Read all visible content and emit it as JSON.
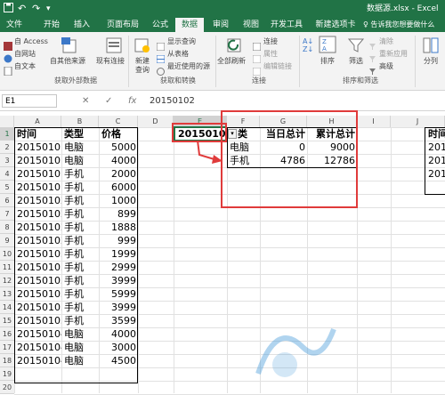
{
  "window": {
    "title": "数据源.xlsx - Excel"
  },
  "quick_access": {
    "undo": "↶",
    "redo": "↷"
  },
  "tabs": [
    "文件",
    "开始",
    "插入",
    "页面布局",
    "公式",
    "数据",
    "审阅",
    "视图",
    "开发工具",
    "新建选项卡"
  ],
  "active_tab": "数据",
  "tell_me": "♀ 告诉我您想要做什么",
  "ribbon": {
    "get_external": {
      "access": "自 Access",
      "web": "自网站",
      "text": "自文本",
      "other": "自其他来源",
      "existing": "现有连接",
      "group": "获取外部数据"
    },
    "get_transform": {
      "new_query": "新建",
      "new_query2": "查询",
      "show_queries": "显示查询",
      "from_table": "从表格",
      "recent": "最近使用的源",
      "group": "获取和转换"
    },
    "connections": {
      "refresh_all": "全部刷新",
      "connections": "连接",
      "properties": "属性",
      "edit_links": "编辑链接",
      "group": "连接"
    },
    "sort_filter": {
      "sort": "排序",
      "filter": "筛选",
      "clear": "清除",
      "reapply": "重新应用",
      "advanced": "高级",
      "group": "排序和筛选"
    },
    "data_tools": {
      "split": "分列"
    }
  },
  "formula_bar": {
    "name_box": "E1",
    "cancel": "✕",
    "enter": "✓",
    "fx": "fx",
    "value": "20150102"
  },
  "columns": [
    "A",
    "B",
    "C",
    "D",
    "E",
    "F",
    "G",
    "H",
    "I",
    "J"
  ],
  "rows": [
    "1",
    "2",
    "3",
    "4",
    "5",
    "6",
    "7",
    "8",
    "9",
    "10",
    "11",
    "12",
    "13",
    "14",
    "15",
    "16",
    "17",
    "18",
    "19",
    "20"
  ],
  "table1": {
    "headers": [
      "时间",
      "类型",
      "价格"
    ],
    "rows": [
      [
        "20150101",
        "电脑",
        "5000"
      ],
      [
        "20150101",
        "电脑",
        "4000"
      ],
      [
        "20150101",
        "手机",
        "2000"
      ],
      [
        "20150101",
        "手机",
        "6000"
      ],
      [
        "20150102",
        "手机",
        "1000"
      ],
      [
        "20150102",
        "手机",
        "899"
      ],
      [
        "20150102",
        "手机",
        "1888"
      ],
      [
        "20150102",
        "手机",
        "999"
      ],
      [
        "20150103",
        "手机",
        "1999"
      ],
      [
        "20150103",
        "手机",
        "2999"
      ],
      [
        "20150103",
        "手机",
        "3999"
      ],
      [
        "20150103",
        "手机",
        "5999"
      ],
      [
        "20150103",
        "手机",
        "3999"
      ],
      [
        "20150103",
        "手机",
        "3599"
      ],
      [
        "20150104",
        "电脑",
        "4000"
      ],
      [
        "20150104",
        "电脑",
        "3000"
      ],
      [
        "20150104",
        "电脑",
        "4500"
      ]
    ]
  },
  "e1_value": "20150102",
  "summary": {
    "headers": [
      "类",
      "当日总计",
      "累计总计"
    ],
    "rows": [
      [
        "电脑",
        "0",
        "9000"
      ],
      [
        "手机",
        "4786",
        "12786"
      ]
    ]
  },
  "col_j": [
    "时间",
    "201",
    "201",
    "201"
  ],
  "colors": {
    "excel_green": "#217346",
    "highlight_red": "#e03b3b"
  }
}
